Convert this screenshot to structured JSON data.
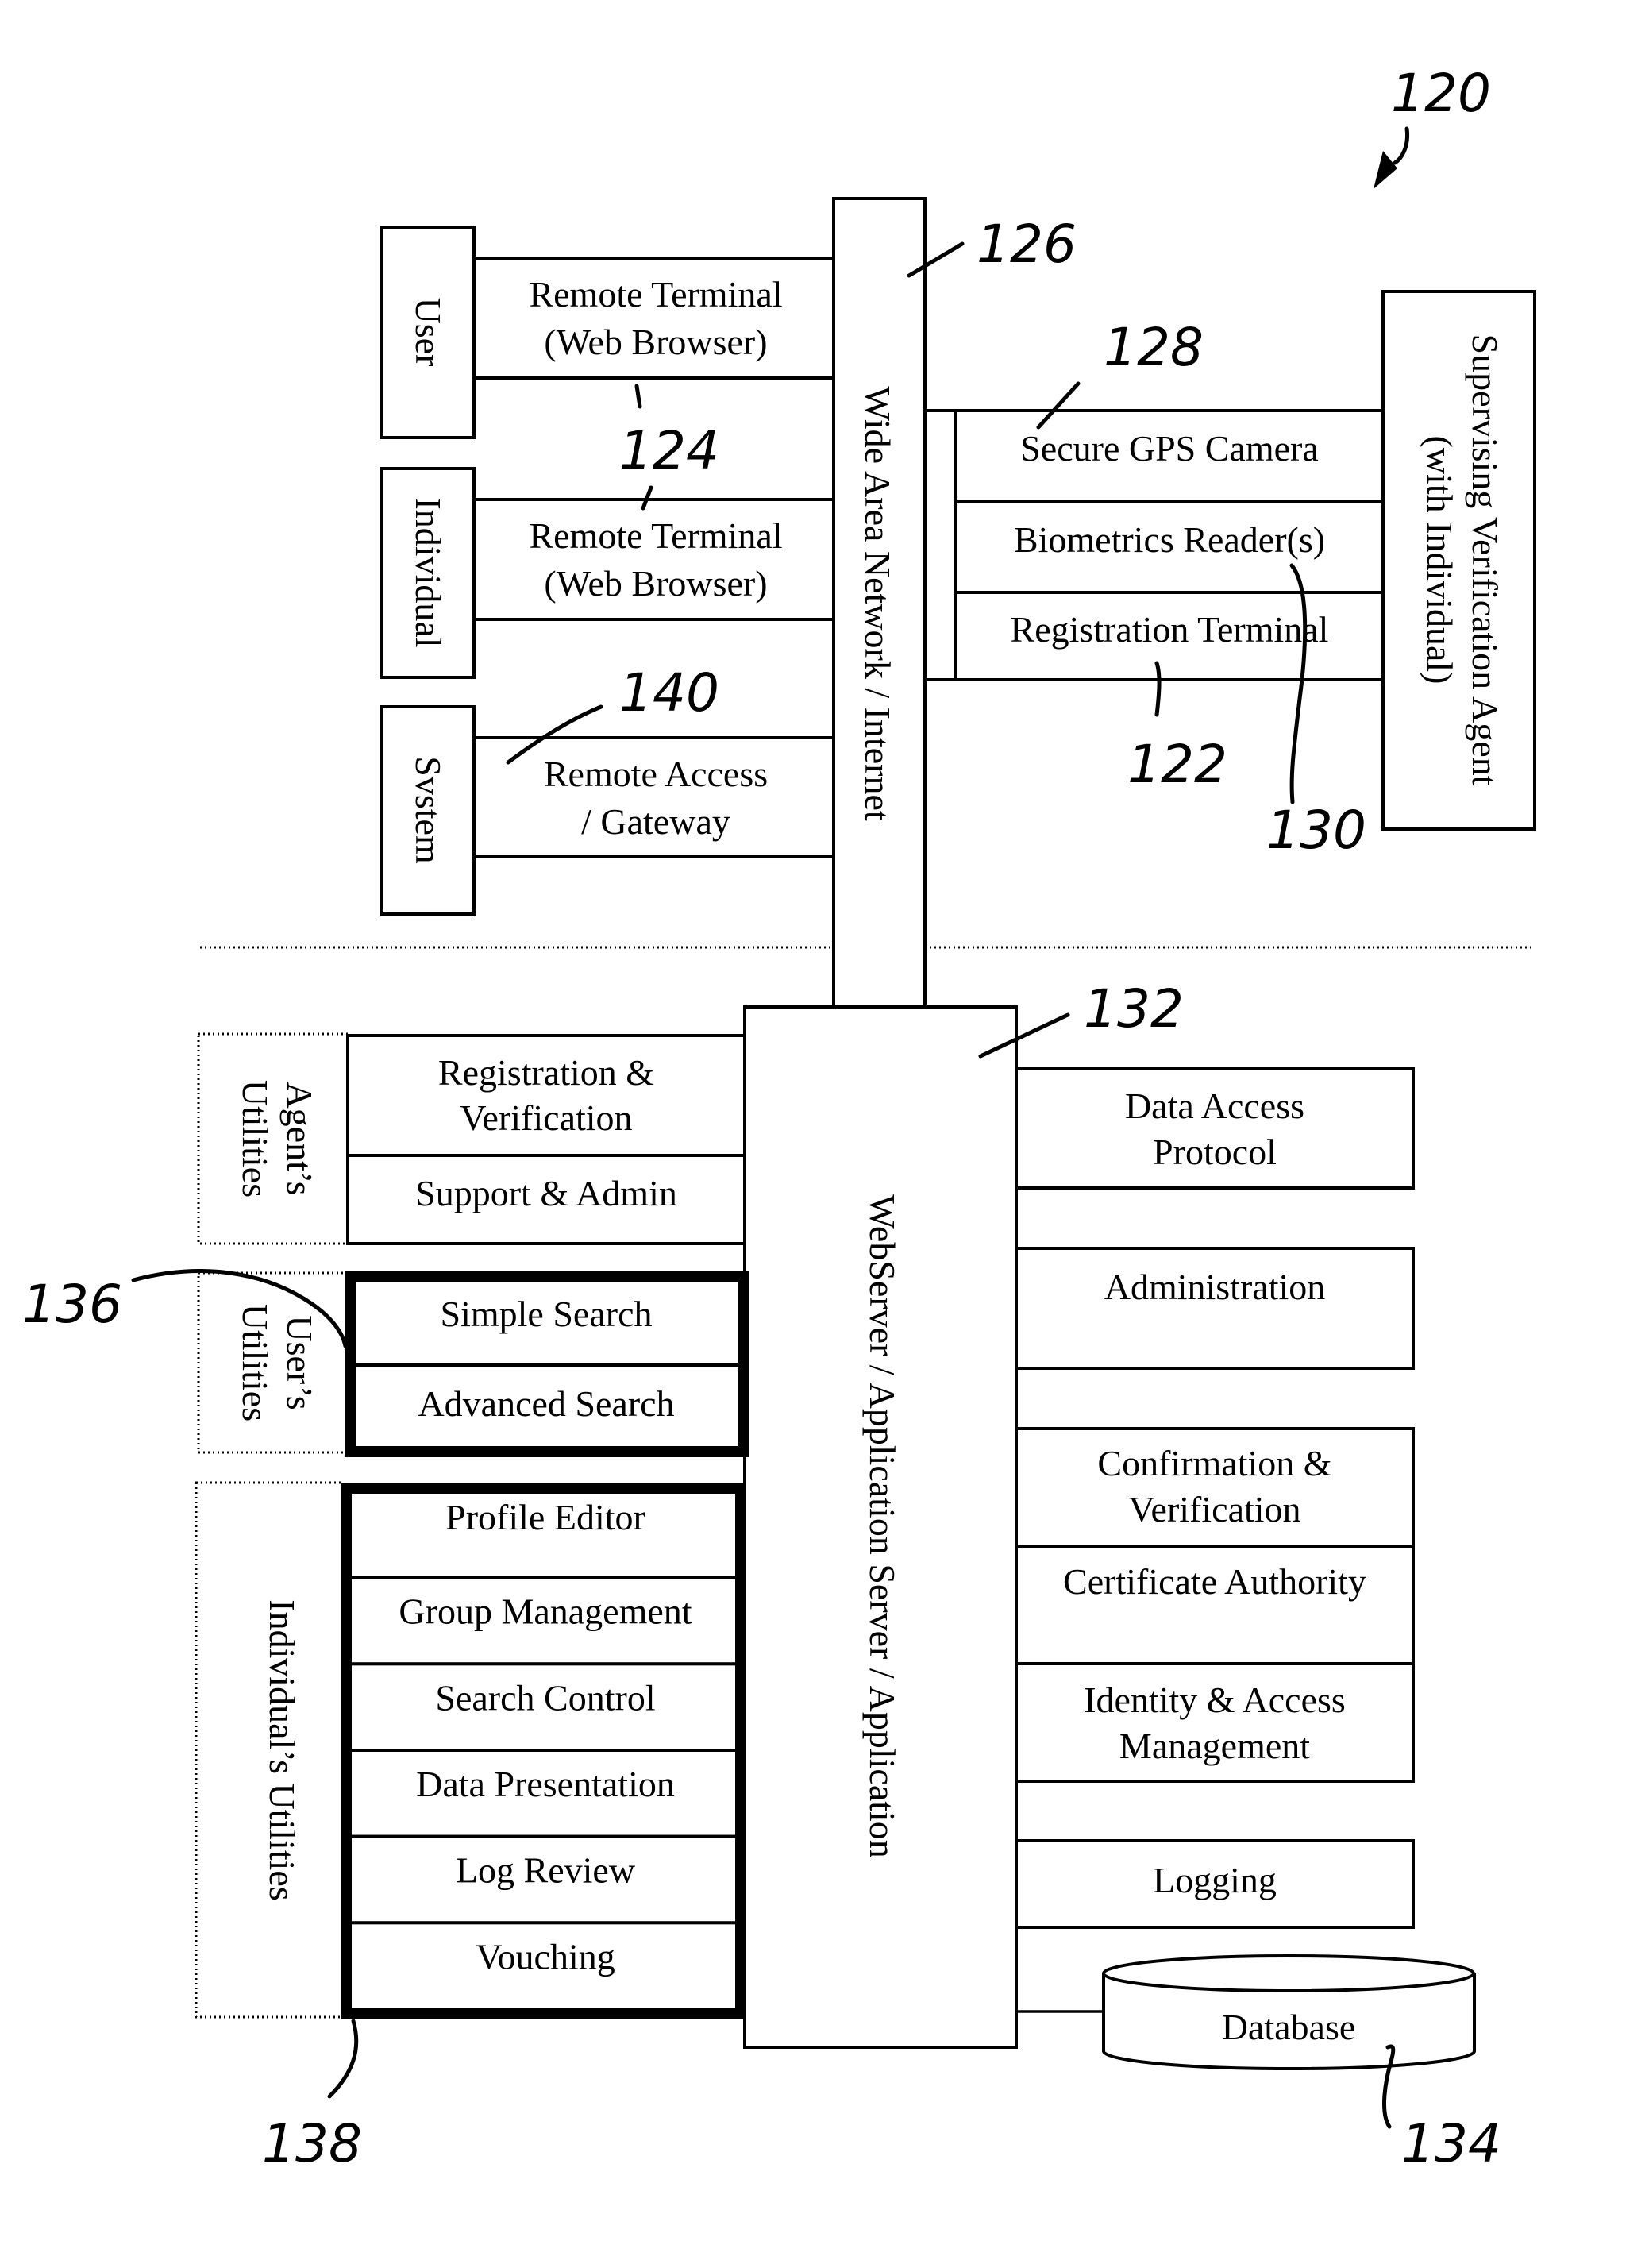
{
  "figure_number": "120",
  "references": {
    "r122": "122",
    "r124": "124",
    "r126": "126",
    "r128": "128",
    "r130": "130",
    "r132": "132",
    "r134": "134",
    "r136": "136",
    "r138": "138",
    "r140": "140"
  },
  "top": {
    "wan_label": "Wide Area Network / Internet",
    "clients": [
      {
        "actor": "User",
        "terminal": [
          "Remote Terminal",
          "(Web Browser)"
        ]
      },
      {
        "actor": "Individual",
        "terminal": [
          "Remote Terminal",
          "(Web Browser)"
        ]
      },
      {
        "actor": "Svstem",
        "terminal": [
          "Remote Access",
          "/ Gateway"
        ]
      }
    ],
    "devices": [
      "Secure GPS Camera",
      "Biometrics Reader(s)",
      "Registration Terminal"
    ],
    "agent": [
      "Supervising Verification Agent",
      "(with Individual)"
    ]
  },
  "bottom": {
    "server_label": "WebServer / Application Server / Application",
    "agents_utilities": {
      "label": [
        "Agent’s",
        "Utilities"
      ],
      "items": [
        [
          "Registration &",
          "Verification"
        ],
        [
          "Support & Admin"
        ]
      ]
    },
    "users_utilities": {
      "label": [
        "User’s",
        "Utilities"
      ],
      "items": [
        "Simple Search",
        "Advanced Search"
      ]
    },
    "individuals_utilities": {
      "label": "Individual’s Utilities",
      "items": [
        "Profile Editor",
        "Group Management",
        "Search Control",
        "Data Presentation",
        "Log Review",
        "Vouching"
      ]
    },
    "services": {
      "data_access": [
        "Data Access",
        "Protocol"
      ],
      "administration": "Administration",
      "confirmation": [
        "Confirmation &",
        "Verification"
      ],
      "certificate": "Certificate Authority",
      "identity": [
        "Identity & Access",
        "Management"
      ],
      "logging": "Logging"
    },
    "database": "Database"
  }
}
